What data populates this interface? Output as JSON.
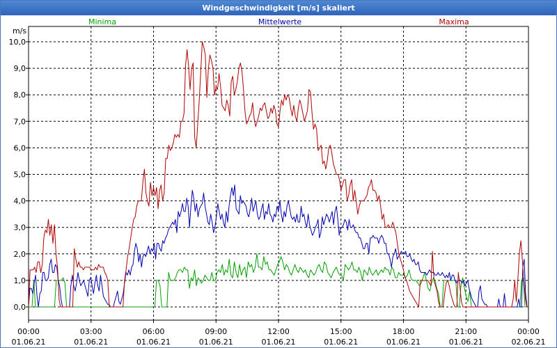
{
  "window_title": "Windgeschwindigkeit [m/s] skaliert",
  "chart_data": {
    "type": "line",
    "title": "Windgeschwindigkeit [m/s] skaliert",
    "ylabel": "m/s",
    "ylim": [
      0,
      10
    ],
    "y_ticks": [
      "0,0",
      "1,0",
      "2,0",
      "3,0",
      "4,0",
      "5,0",
      "6,0",
      "7,0",
      "8,0",
      "9,0",
      "10,0"
    ],
    "x_range_hours": [
      0,
      24
    ],
    "x_ticks": [
      {
        "time": "00:00",
        "date": "01.06.21"
      },
      {
        "time": "03:00",
        "date": "01.06.21"
      },
      {
        "time": "06:00",
        "date": "01.06.21"
      },
      {
        "time": "09:00",
        "date": "01.06.21"
      },
      {
        "time": "12:00",
        "date": "01.06.21"
      },
      {
        "time": "15:00",
        "date": "01.06.21"
      },
      {
        "time": "18:00",
        "date": "01.06.21"
      },
      {
        "time": "21:00",
        "date": "01.06.21"
      },
      {
        "time": "00:00",
        "date": "02.06.21"
      }
    ],
    "grid": true,
    "series": [
      {
        "name": "Minima",
        "color": "#00a000",
        "values": [
          0.0,
          0.0,
          0.0,
          1.0,
          0.0,
          0.0,
          0.0,
          0.0,
          0.0,
          0.0,
          0.0,
          0.0,
          0.0,
          0.0,
          0.0,
          0.0,
          1.0,
          1.0,
          1.0,
          1.0,
          1.1,
          0.9,
          0.0,
          0.0,
          0.0,
          0.0,
          0.0,
          0.0,
          0.0,
          0.0,
          0.0,
          0.0,
          0.0,
          0.0,
          0.0,
          0.0,
          0.0,
          0.0,
          0.0,
          0.0,
          0.0,
          0.0,
          0.0,
          0.0,
          0.0,
          0.0,
          0.0,
          0.0,
          0.0,
          0.0,
          0.0,
          0.0,
          0.0,
          0.0,
          0.0,
          0.0,
          0.0,
          0.0,
          0.0,
          0.0,
          0.0,
          0.0,
          0.0,
          0.0,
          0.0,
          0.0,
          0.0,
          0.0,
          0.0,
          0.0,
          0.0,
          0.0,
          0.0,
          0.0,
          1.0,
          1.0,
          0.8,
          0.0,
          0.0,
          0.0,
          0.0,
          1.3,
          1.0,
          1.0,
          1.0,
          1.1,
          1.3,
          1.4,
          1.4,
          1.3,
          1.5,
          1.4,
          1.4,
          0.7,
          1.1,
          1.0,
          1.4,
          0.8,
          1.1,
          1.0,
          0.9,
          1.0,
          1.2,
          1.1,
          1.0,
          1.0,
          1.3,
          1.0,
          1.0,
          1.3,
          1.4,
          1.3,
          1.6,
          1.2,
          1.4,
          1.3,
          1.8,
          1.2,
          1.1,
          1.7,
          1.3,
          1.1,
          1.6,
          1.2,
          1.4,
          1.5,
          1.1,
          1.7,
          1.5,
          1.6,
          1.3,
          1.5,
          2.0,
          1.5,
          1.5,
          1.4,
          1.9,
          1.6,
          1.7,
          1.4,
          1.4,
          1.3,
          1.2,
          1.4,
          1.6,
          1.7,
          1.9,
          1.7,
          1.4,
          1.6,
          1.5,
          1.3,
          1.2,
          1.4,
          1.6,
          1.4,
          1.3,
          1.5,
          1.4,
          1.3,
          1.4,
          1.2,
          1.1,
          1.4,
          1.3,
          1.2,
          1.3,
          1.5,
          1.6,
          1.4,
          1.3,
          1.7,
          1.6,
          1.3,
          1.2,
          1.1,
          1.3,
          1.4,
          1.5,
          1.3,
          1.2,
          1.2,
          1.0,
          1.6,
          1.5,
          1.4,
          1.5,
          1.7,
          1.4,
          1.4,
          1.3,
          1.5,
          1.3,
          1.0,
          1.4,
          1.3,
          1.2,
          1.5,
          1.3,
          1.2,
          1.3,
          1.4,
          1.2,
          1.3,
          1.4,
          1.3,
          1.5,
          1.4,
          1.4,
          1.2,
          1.5,
          1.4,
          1.1,
          1.1,
          1.3,
          1.2,
          1.2,
          1.2,
          1.1,
          1.2,
          1.4,
          1.1,
          1.0,
          1.0,
          1.0,
          0.9,
          0.8,
          0.9,
          1.1,
          1.3,
          1.0,
          0.7,
          0.6,
          0.9,
          1.1,
          1.0,
          0.7,
          0.5,
          0.0,
          0.0,
          1.0,
          1.0,
          1.0,
          1.0,
          1.0,
          1.0,
          1.0,
          1.0,
          0.0,
          0.0,
          0.8,
          1.1,
          0.7,
          0.4,
          0.2,
          0.6,
          0.0,
          0.0,
          0.0,
          0.0,
          0.0,
          0.0,
          0.0,
          0.0,
          0.0,
          0.0,
          0.0,
          0.0,
          0.0,
          0.0,
          0.0,
          0.0,
          0.0,
          0.0,
          0.0,
          0.0,
          0.0,
          0.0,
          0.0,
          0.0,
          0.0,
          0.0,
          0.0,
          0.0,
          0.0,
          1.0,
          1.1,
          0.0,
          0.0,
          0.0
        ]
      },
      {
        "name": "Mittelwerte",
        "color": "#0000b0",
        "values": [
          0.0,
          0.7,
          0.7,
          0.5,
          0.9,
          1.2,
          0.4,
          0.0,
          0.5,
          0.6,
          1.3,
          1.3,
          1.0,
          1.0,
          1.1,
          1.6,
          1.8,
          1.3,
          1.3,
          1.6,
          1.5,
          1.0,
          0.8,
          0.3,
          0.0,
          0.0,
          0.0,
          0.0,
          0.0,
          0.0,
          0.8,
          1.2,
          0.8,
          0.6,
          0.9,
          1.3,
          1.0,
          0.8,
          0.9,
          1.0,
          0.8,
          0.6,
          0.4,
          1.0,
          1.1,
          0.8,
          0.5,
          0.9,
          1.2,
          0.8,
          0.6,
          1.2,
          0.8,
          0.4,
          0.3,
          0.2,
          0.1,
          0.1,
          0.0,
          0.0,
          0.0,
          0.2,
          0.4,
          0.6,
          0.2,
          0.1,
          0.3,
          0.5,
          0.9,
          1.3,
          1.2,
          1.4,
          1.2,
          1.5,
          1.6,
          2.1,
          2.4,
          2.2,
          1.7,
          2.0,
          1.5,
          1.9,
          2.0,
          1.9,
          2.1,
          2.3,
          2.0,
          2.2,
          2.1,
          2.4,
          1.8,
          2.4,
          2.4,
          2.2,
          2.1,
          2.5,
          2.4,
          2.6,
          2.7,
          2.9,
          3.0,
          3.1,
          3.2,
          3.1,
          3.3,
          2.8,
          3.6,
          3.4,
          3.6,
          3.9,
          3.6,
          3.6,
          4.1,
          3.8,
          3.0,
          3.8,
          4.4,
          4.1,
          3.6,
          3.9,
          3.4,
          3.7,
          3.8,
          3.9,
          4.3,
          3.8,
          3.5,
          3.2,
          3.1,
          3.5,
          3.2,
          2.8,
          3.0,
          3.4,
          3.9,
          3.6,
          3.3,
          3.5,
          3.2,
          3.0,
          3.6,
          3.2,
          3.8,
          4.2,
          4.5,
          4.2,
          4.6,
          3.7,
          3.6,
          3.5,
          4.2,
          3.9,
          4.0,
          3.9,
          3.8,
          3.5,
          3.4,
          3.7,
          4.1,
          3.6,
          3.8,
          4.0,
          3.5,
          3.3,
          3.4,
          3.7,
          3.9,
          3.3,
          3.6,
          3.5,
          3.9,
          3.5,
          3.4,
          3.2,
          3.5,
          3.4,
          3.8,
          3.6,
          4.0,
          3.5,
          3.2,
          3.6,
          3.4,
          3.8,
          4.0,
          3.7,
          3.4,
          3.3,
          3.4,
          3.2,
          3.5,
          3.2,
          3.2,
          3.8,
          3.4,
          3.5,
          3.2,
          3.0,
          3.5,
          3.1,
          2.9,
          2.7,
          2.8,
          3.0,
          3.1,
          3.3,
          2.6,
          2.8,
          3.4,
          3.1,
          3.3,
          3.5,
          3.4,
          3.2,
          3.4,
          3.6,
          3.1,
          3.6,
          3.8,
          3.3,
          2.7,
          3.0,
          3.0,
          3.1,
          3.3,
          3.2,
          2.9,
          3.3,
          3.0,
          3.0,
          3.1,
          2.9,
          2.8,
          2.8,
          2.6,
          2.6,
          2.4,
          2.2,
          2.2,
          2.4,
          2.4,
          2.0,
          2.6,
          2.6,
          2.7,
          2.6,
          2.6,
          2.6,
          2.4,
          2.6,
          2.7,
          2.6,
          2.4,
          2.4,
          2.0,
          2.0,
          1.8,
          1.5,
          1.9,
          2.0,
          2.2,
          1.8,
          1.9,
          2.0,
          2.1,
          2.0,
          2.0,
          2.1,
          1.9,
          1.9,
          2.0,
          1.8,
          1.7,
          1.8,
          1.6,
          1.6,
          1.7,
          1.4,
          1.3,
          1.3,
          1.3,
          1.3,
          1.2,
          1.3,
          1.4,
          1.3,
          1.3,
          1.3,
          1.2,
          1.2,
          1.3,
          1.2,
          1.2,
          1.3,
          1.2,
          1.1,
          1.2,
          1.1,
          1.3,
          1.0,
          1.2,
          1.2,
          1.0,
          0.9,
          1.0,
          1.0,
          1.0,
          0.9,
          1.0,
          0.8,
          0.9,
          1.0,
          0.7,
          0.5,
          0.3,
          0.2,
          0.1,
          0.0,
          0.0,
          0.6,
          0.8,
          0.3,
          0.2,
          0.1,
          0.1,
          0.0,
          0.0,
          0.0,
          0.0,
          0.0,
          0.0,
          0.0,
          0.0,
          0.3,
          0.0,
          0.0,
          0.0,
          0.5,
          0.0,
          0.0,
          0.0,
          0.0,
          0.0,
          0.0,
          0.0,
          0.0,
          0.0,
          0.3,
          0.0,
          0.0,
          1.5,
          1.8,
          0.5,
          0.0,
          0.0
        ]
      },
      {
        "name": "Maxima",
        "color": "#b00000",
        "values": [
          0.0,
          1.4,
          1.4,
          1.4,
          1.5,
          1.3,
          1.7,
          1.7,
          1.3,
          1.6,
          2.6,
          2.9,
          2.8,
          3.3,
          2.7,
          3.1,
          2.4,
          3.1,
          2.0,
          1.5,
          0.3,
          0.0,
          0.0,
          0.0,
          0.0,
          0.0,
          0.0,
          0.0,
          0.0,
          0.0,
          2.2,
          1.8,
          1.5,
          1.7,
          1.5,
          1.5,
          1.4,
          1.5,
          1.5,
          1.5,
          1.5,
          1.4,
          1.4,
          1.4,
          1.5,
          1.4,
          1.6,
          1.5,
          1.5,
          1.5,
          1.3,
          1.2,
          1.0,
          0.0,
          0.0,
          0.0,
          0.0,
          0.0,
          0.0,
          0.0,
          0.0,
          0.0,
          0.0,
          1.0,
          1.4,
          1.9,
          2.2,
          2.6,
          3.0,
          3.3,
          3.4,
          3.8,
          4.0,
          4.0,
          4.0,
          4.7,
          5.2,
          4.3,
          4.0,
          3.8,
          4.7,
          4.2,
          4.5,
          4.2,
          4.5,
          3.7,
          4.4,
          4.6,
          4.0,
          4.3,
          5.6,
          5.6,
          6.1,
          5.9,
          6.0,
          6.2,
          6.5,
          6.4,
          6.5,
          6.4,
          7.0,
          7.0,
          7.3,
          9.1,
          9.7,
          9.1,
          8.2,
          9.0,
          9.2,
          6.4,
          6.0,
          6.9,
          7.8,
          8.9,
          10.0,
          9.8,
          9.5,
          7.9,
          9.0,
          9.5,
          9.3,
          9.0,
          8.0,
          8.3,
          8.2,
          8.8,
          8.3,
          7.6,
          7.5,
          7.4,
          7.8,
          7.6,
          7.2,
          8.5,
          8.7,
          8.0,
          8.2,
          8.5,
          9.0,
          9.2,
          8.9,
          8.2,
          7.4,
          6.9,
          7.0,
          7.2,
          7.3,
          7.7,
          7.1,
          6.8,
          7.0,
          7.2,
          7.5,
          7.4,
          7.6,
          7.7,
          7.4,
          7.1,
          7.2,
          7.5,
          7.3,
          7.6,
          7.4,
          6.9,
          6.8,
          7.4,
          7.8,
          7.6,
          8.0,
          7.8,
          8.0,
          7.9,
          7.5,
          7.2,
          7.6,
          7.2,
          7.0,
          7.5,
          7.8,
          7.6,
          7.3,
          7.0,
          7.2,
          7.4,
          8.2,
          8.1,
          7.3,
          6.7,
          6.9,
          6.7,
          5.9,
          6.0,
          6.1,
          5.4,
          5.5,
          5.2,
          5.5,
          6.0,
          6.1,
          5.8,
          5.4,
          5.2,
          5.0,
          5.0,
          4.8,
          4.4,
          4.6,
          4.8,
          4.8,
          4.0,
          4.2,
          4.6,
          4.8,
          4.0,
          4.4,
          4.0,
          3.5,
          3.8,
          4.0,
          4.0,
          4.0,
          4.1,
          4.2,
          4.5,
          4.6,
          4.8,
          4.4,
          4.4,
          4.3,
          4.0,
          4.2,
          3.8,
          3.3,
          3.5,
          3.0,
          3.0,
          3.1,
          3.0,
          3.0,
          3.2,
          3.0,
          2.8,
          2.4,
          2.0,
          1.8,
          1.6,
          1.4,
          1.1,
          1.0,
          0.8,
          0.6,
          0.5,
          0.4,
          0.3,
          0.2,
          0.1,
          0.0,
          1.0,
          1.0,
          1.0,
          1.0,
          1.0,
          1.0,
          0.9,
          0.8,
          2.1,
          1.0,
          0.8,
          0.6,
          0.2,
          0.0,
          0.0,
          0.0,
          0.5,
          0.9,
          1.0,
          0.8,
          0.5,
          0.3,
          0.1,
          0.0,
          0.0,
          1.3,
          0.8,
          0.2,
          0.0,
          0.0,
          0.0,
          0.0,
          0.0,
          0.0,
          0.0,
          0.0,
          0.0,
          0.0,
          0.0,
          0.0,
          0.0,
          0.0,
          0.0,
          0.0,
          0.0,
          0.0,
          0.0,
          0.0,
          0.0,
          0.0,
          0.0,
          0.0,
          0.0,
          0.0,
          0.0,
          0.0,
          0.0,
          0.0,
          0.0,
          0.0,
          0.0,
          0.3,
          1.0,
          0.2,
          1.0,
          2.0,
          2.5,
          1.8,
          1.0,
          0.3,
          0.0,
          0.0
        ]
      }
    ]
  }
}
